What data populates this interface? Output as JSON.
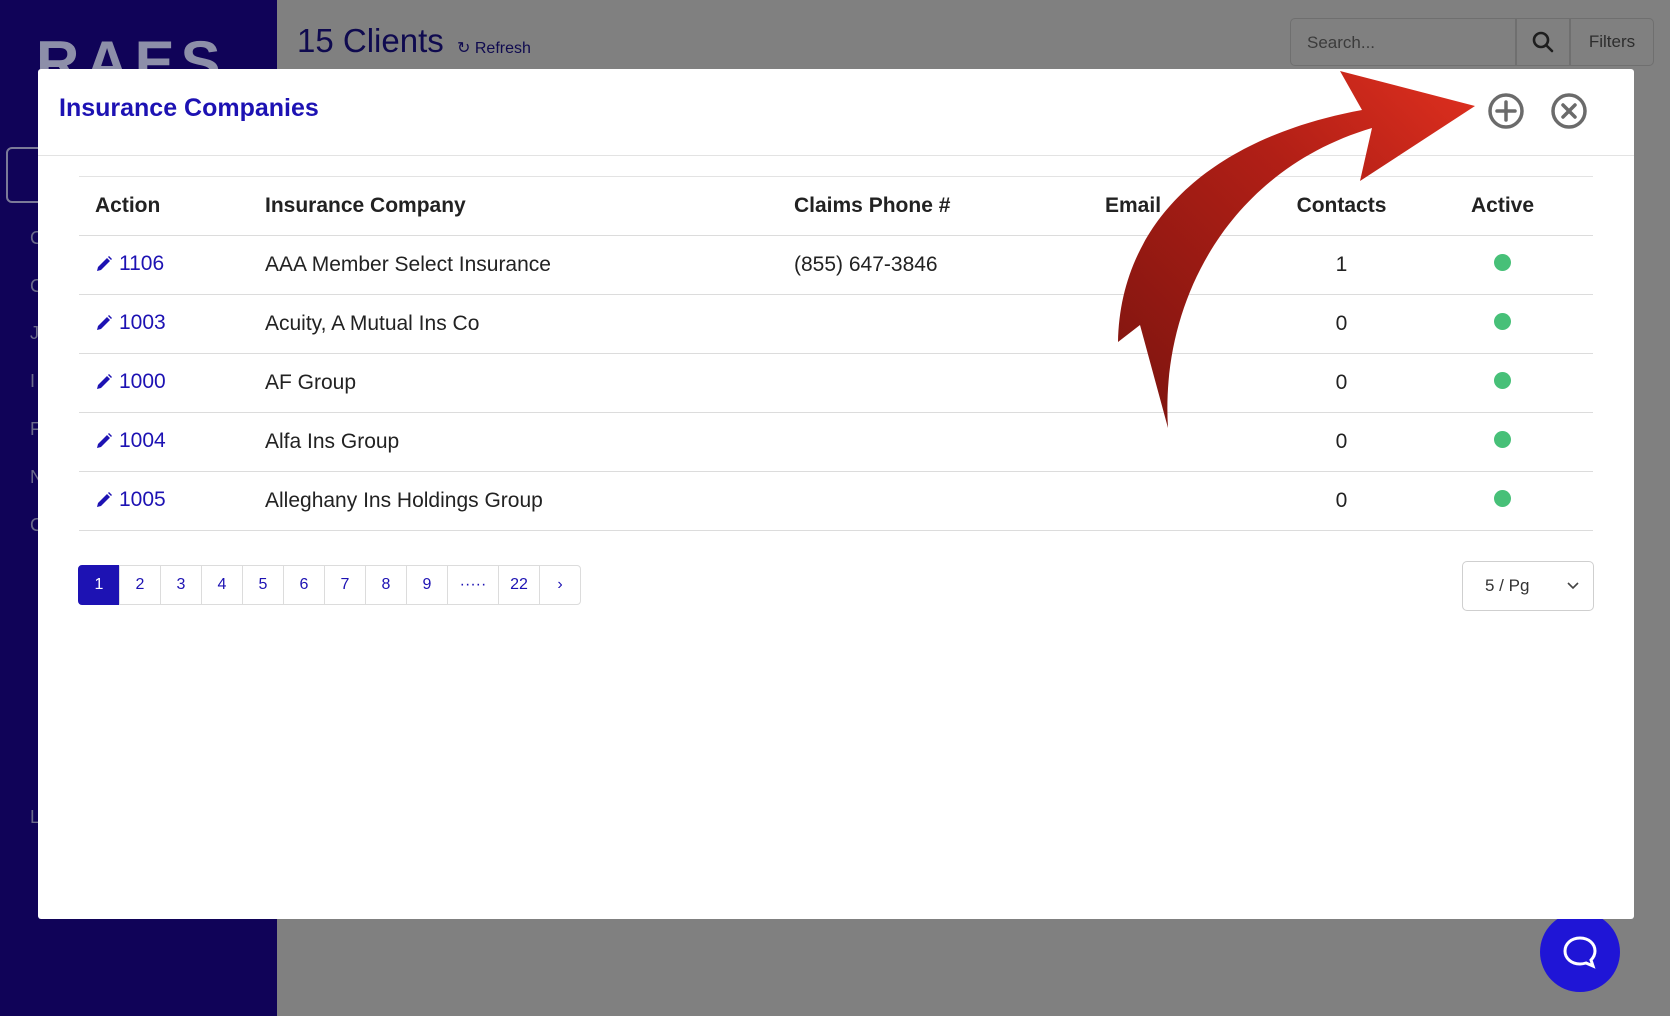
{
  "background": {
    "logo_text": "RAES",
    "sidebar_letters": [
      "C",
      "C",
      "J",
      "I",
      "F",
      "N",
      "C",
      "L"
    ],
    "title": "15 Clients",
    "refresh_label": "Refresh",
    "search_placeholder": "Search...",
    "filters_label": "Filters"
  },
  "modal": {
    "title": "Insurance Companies",
    "columns": [
      "Action",
      "Insurance Company",
      "Claims Phone #",
      "Email",
      "Contacts",
      "Active"
    ],
    "rows": [
      {
        "id": "1106",
        "company": "AAA Member Select Insurance",
        "phone": "(855) 647-3846",
        "email": "",
        "contacts": "1",
        "active": true
      },
      {
        "id": "1003",
        "company": "Acuity, A Mutual Ins Co",
        "phone": "",
        "email": "",
        "contacts": "0",
        "active": true
      },
      {
        "id": "1000",
        "company": "AF Group",
        "phone": "",
        "email": "",
        "contacts": "0",
        "active": true
      },
      {
        "id": "1004",
        "company": "Alfa Ins Group",
        "phone": "",
        "email": "",
        "contacts": "0",
        "active": true
      },
      {
        "id": "1005",
        "company": "Alleghany Ins Holdings Group",
        "phone": "",
        "email": "",
        "contacts": "0",
        "active": true
      }
    ],
    "pagination": [
      "1",
      "2",
      "3",
      "4",
      "5",
      "6",
      "7",
      "8",
      "9",
      "·····",
      "22",
      "›"
    ],
    "current_page": "1",
    "per_page": "5 / Pg"
  },
  "colors": {
    "sidebar": "#100358",
    "accent": "#1d12b3",
    "active_dot": "#47c078",
    "arrow": "#c8271b"
  },
  "icons": [
    "add-circle-icon",
    "close-circle-icon",
    "pencil-icon",
    "search-icon",
    "refresh-icon",
    "chat-icon",
    "chevron-down-icon"
  ]
}
